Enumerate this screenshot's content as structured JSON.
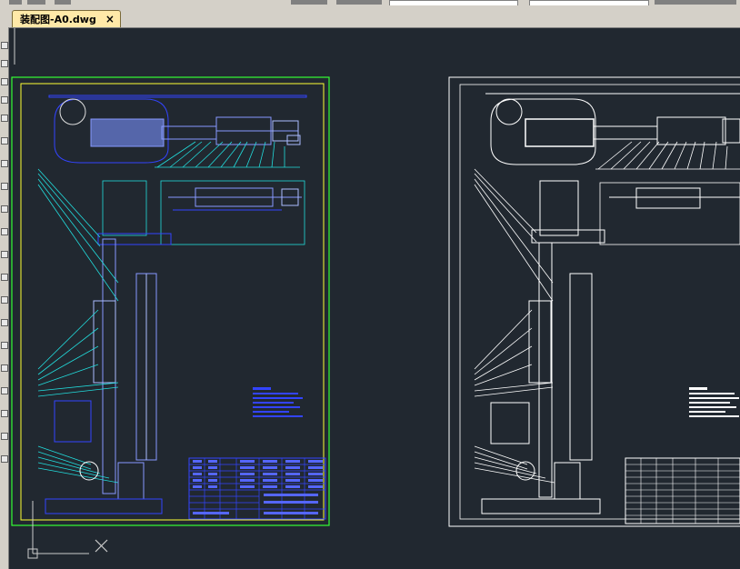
{
  "tabs": [
    {
      "label": "装配图-A0.dwg",
      "close_glyph": "×",
      "active": true
    }
  ],
  "colors": {
    "canvas_bg": "#212830",
    "sheet_frame": "#33ff33",
    "sheet_inner": "#ffff33",
    "blue_lines": "#3344ff",
    "cyan_lines": "#22dddd",
    "white_lines": "#ffffff",
    "tab_bg": "#ffe9a8"
  },
  "icons": {
    "close": "close-icon",
    "ucs": "ucs-icon",
    "crosshair": "crosshair-icon"
  }
}
